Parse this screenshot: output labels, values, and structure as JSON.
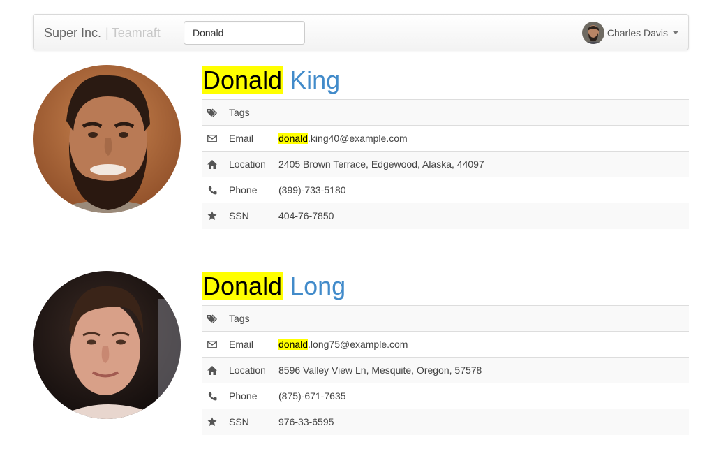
{
  "navbar": {
    "company": "Super Inc.",
    "separator": "|",
    "product": "Teamraft",
    "search_value": "Donald",
    "user_name": "Charles Davis"
  },
  "people": [
    {
      "first_name": "Donald",
      "last_name": "King",
      "rows": {
        "tags": {
          "label": "Tags",
          "value": ""
        },
        "email": {
          "label": "Email",
          "highlight": "donald",
          "rest": ".king40@example.com"
        },
        "location": {
          "label": "Location",
          "value": "2405 Brown Terrace, Edgewood, Alaska, 44097"
        },
        "phone": {
          "label": "Phone",
          "value": "(399)-733-5180"
        },
        "ssn": {
          "label": "SSN",
          "value": "404-76-7850"
        }
      }
    },
    {
      "first_name": "Donald",
      "last_name": "Long",
      "rows": {
        "tags": {
          "label": "Tags",
          "value": ""
        },
        "email": {
          "label": "Email",
          "highlight": "donald",
          "rest": ".long75@example.com"
        },
        "location": {
          "label": "Location",
          "value": "8596 Valley View Ln, Mesquite, Oregon, 57578"
        },
        "phone": {
          "label": "Phone",
          "value": "(875)-671-7635"
        },
        "ssn": {
          "label": "SSN",
          "value": "976-33-6595"
        }
      }
    }
  ],
  "colors": {
    "accent": "#428bca",
    "highlight": "#ffff00",
    "row_stripe": "#f9f9f9",
    "border": "#dddddd"
  },
  "icons": [
    "tags-icon",
    "envelope-icon",
    "home-icon",
    "phone-icon",
    "star-icon",
    "caret-down-icon"
  ]
}
